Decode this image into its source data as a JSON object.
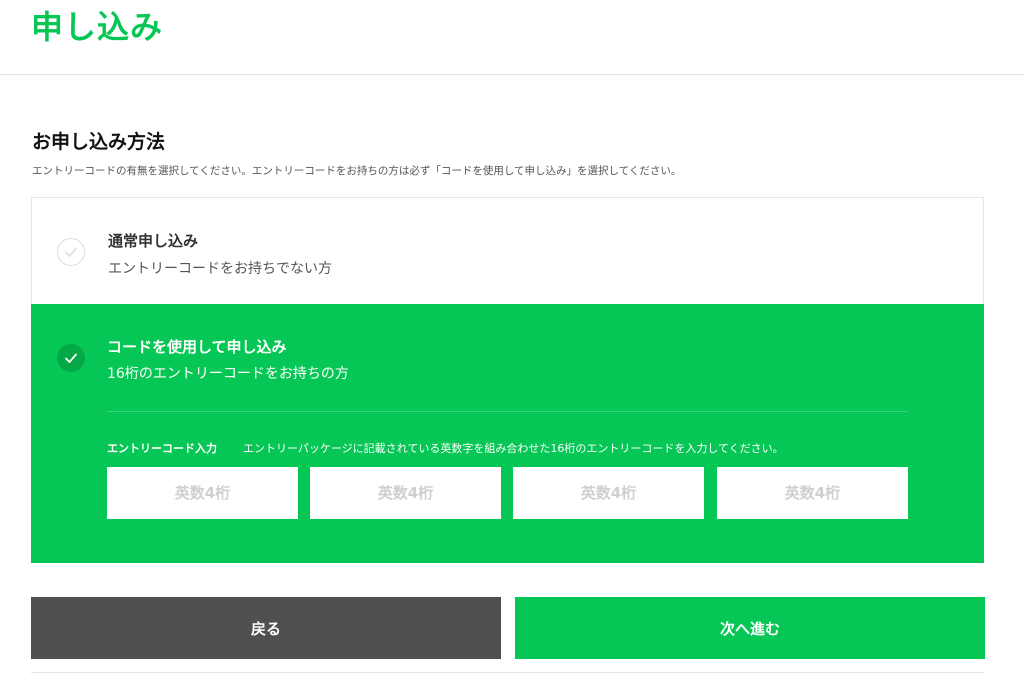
{
  "header": {
    "title": "申し込み"
  },
  "section": {
    "title": "お申し込み方法",
    "description": "エントリーコードの有無を選択してください。エントリーコードをお持ちの方は必ず「コードを使用して申し込み」を選択してください。"
  },
  "options": {
    "normal": {
      "title": "通常申し込み",
      "subtitle": "エントリーコードをお持ちでない方",
      "selected": false
    },
    "code": {
      "title": "コードを使用して申し込み",
      "subtitle": "16桁のエントリーコードをお持ちの方",
      "selected": true,
      "input_label": "エントリーコード入力",
      "input_hint": "エントリーパッケージに記載されている英数字を組み合わせた16桁のエントリーコードを入力してください。",
      "inputs": [
        {
          "value": "",
          "placeholder": "英数4桁"
        },
        {
          "value": "",
          "placeholder": "英数4桁"
        },
        {
          "value": "",
          "placeholder": "英数4桁"
        },
        {
          "value": "",
          "placeholder": "英数4桁"
        }
      ]
    }
  },
  "buttons": {
    "back_label": "戻る",
    "next_label": "次へ進む"
  },
  "colors": {
    "brand_green": "#06c755",
    "check_dark_green": "#05a846",
    "back_button": "#505050"
  },
  "icons": {
    "check": "check-icon"
  }
}
